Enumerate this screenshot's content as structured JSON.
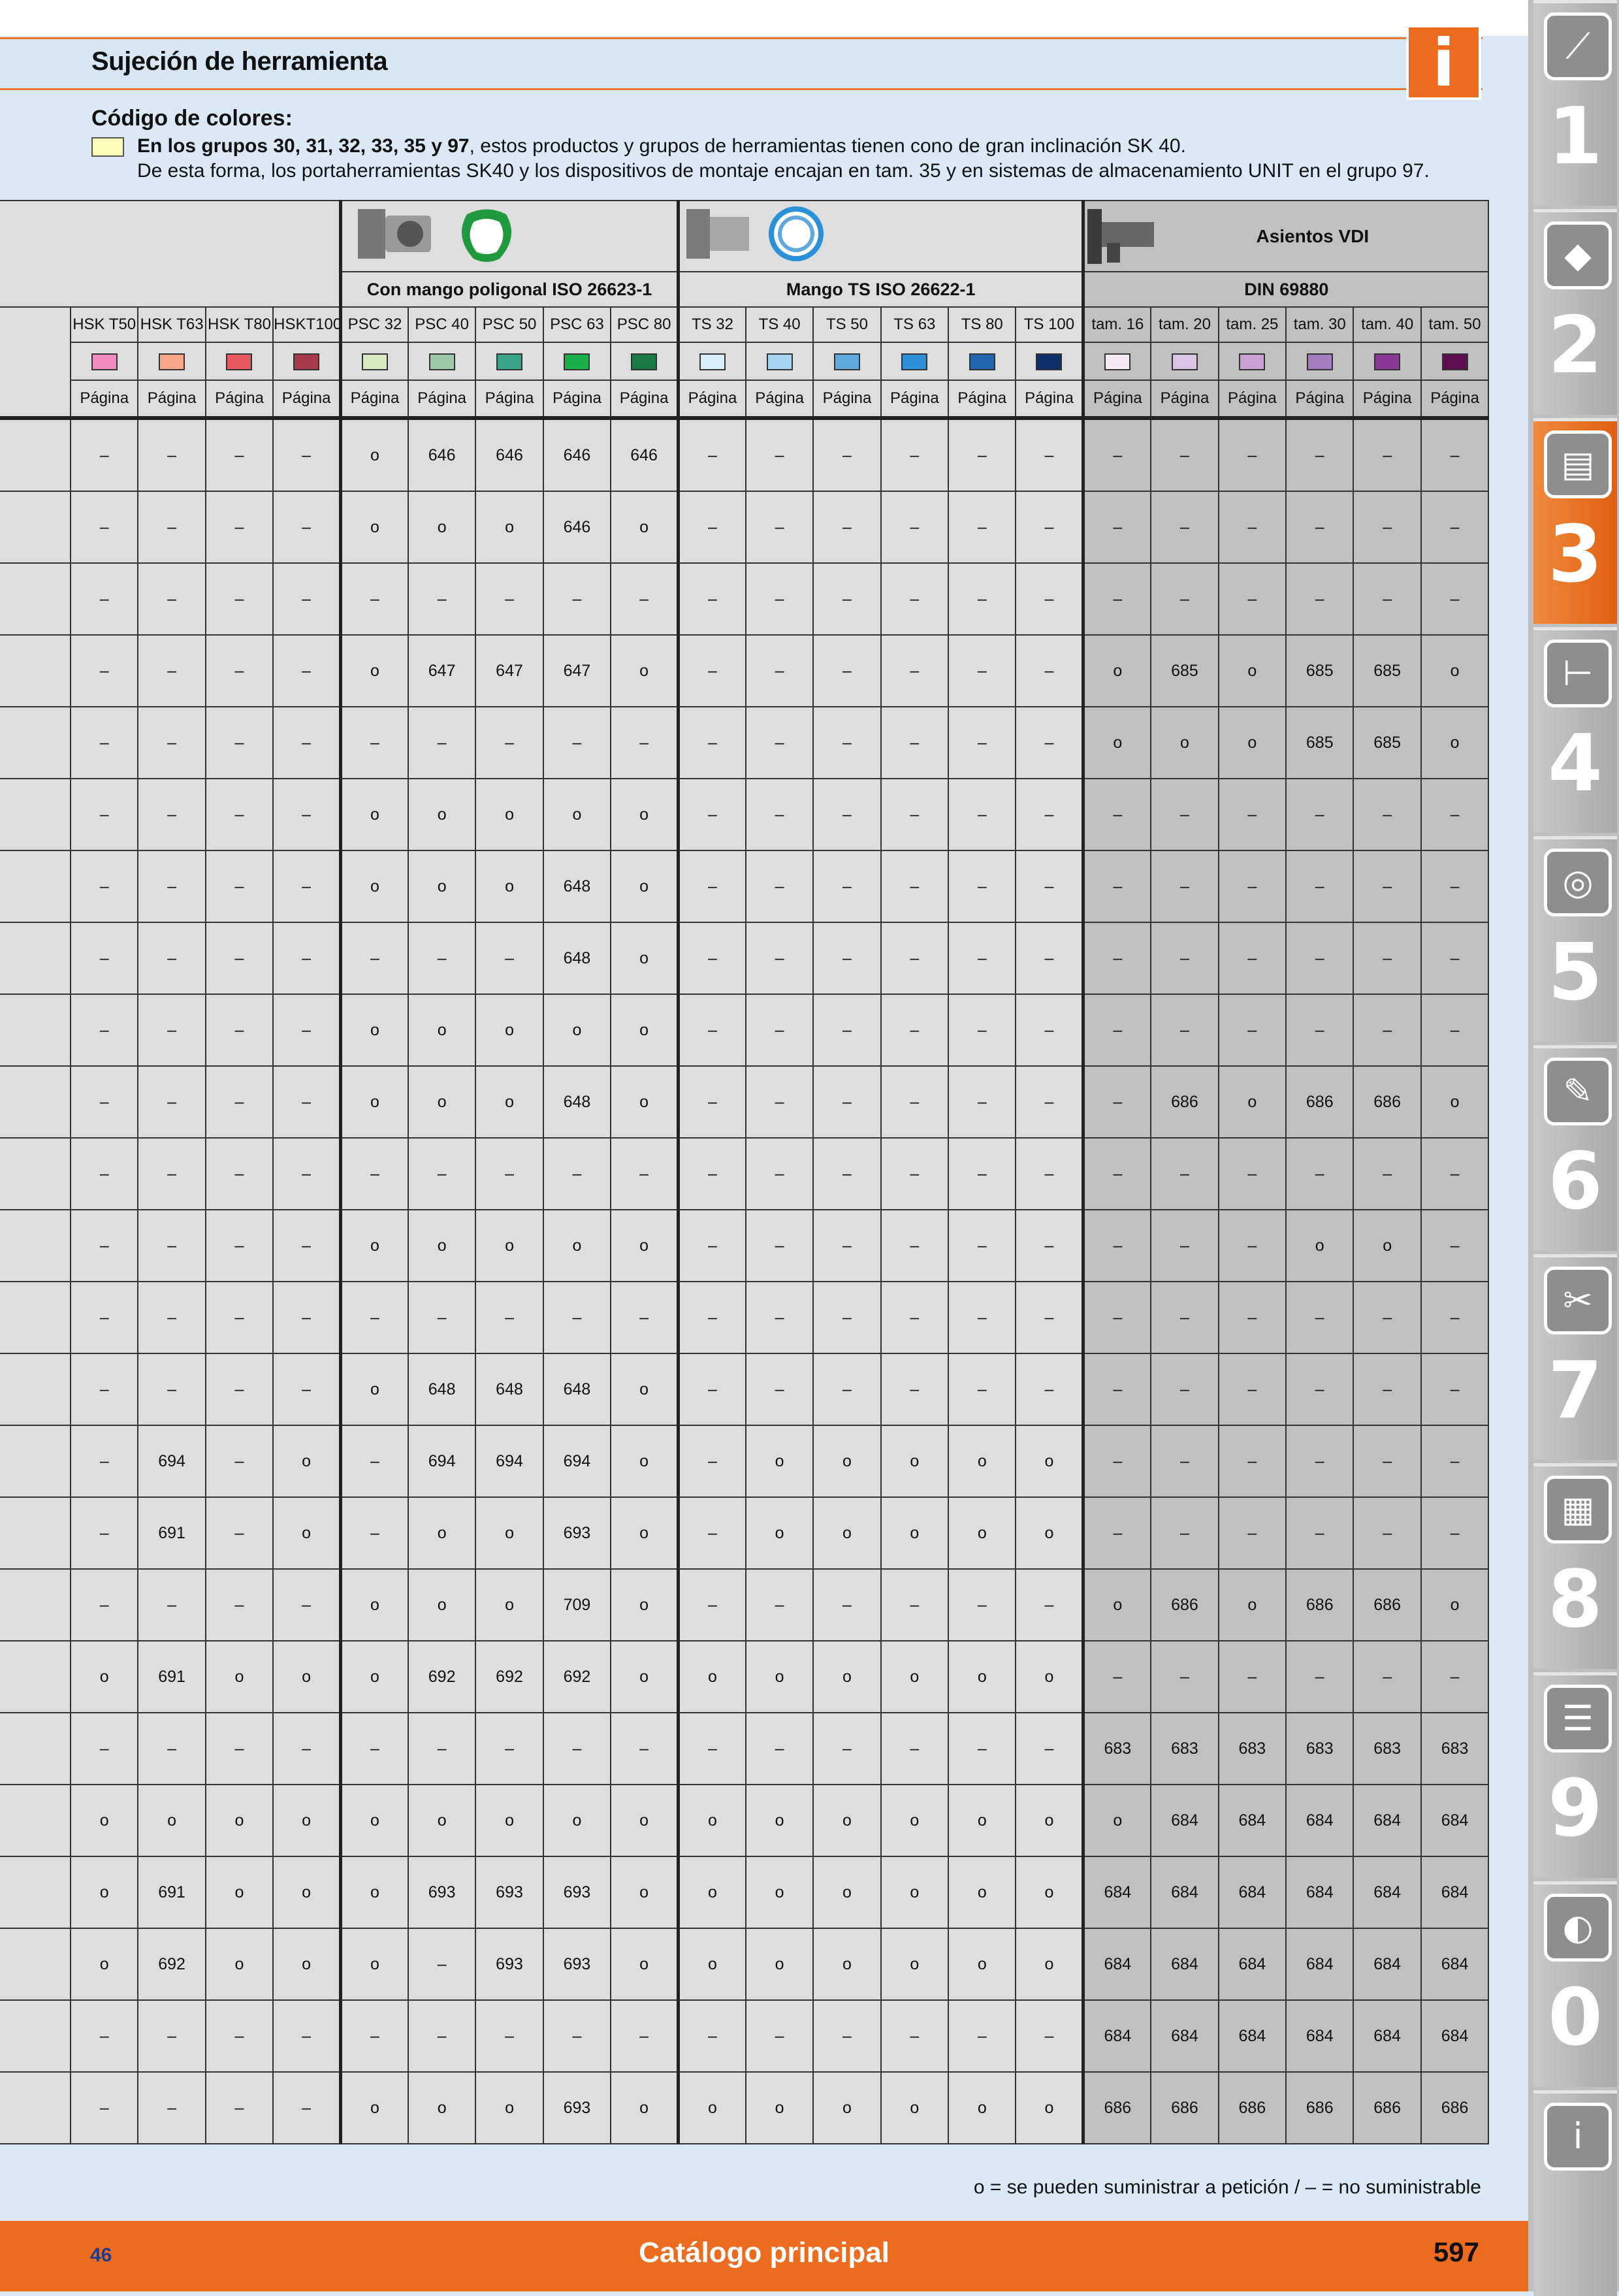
{
  "header": {
    "title": "Sujeción de herramienta",
    "info_icon": "i"
  },
  "legend": {
    "heading": "Código de colores:",
    "line1_bold": "En los grupos 30, 31, 32, 33, 35 y 97",
    "line1_rest": ", estos productos y grupos de herramientas tienen cono de gran inclinación SK 40.",
    "line2": "De esta forma, los portaherramientas SK40 y los dispositivos de montaje encajan en tam. 35 y en sistemas de almacenamiento UNIT en el grupo 97."
  },
  "table": {
    "vdi_heading": "Asientos VDI",
    "groups": [
      "Con mango poligonal ISO 26623-1",
      "Mango TS ISO 26622-1",
      "DIN 69880"
    ],
    "columns": [
      "HSK T50",
      "HSK T63",
      "HSK T80",
      "HSKT100",
      "PSC 32",
      "PSC 40",
      "PSC 50",
      "PSC 63",
      "PSC 80",
      "TS 32",
      "TS 40",
      "TS 50",
      "TS 63",
      "TS 80",
      "TS 100",
      "tam. 16",
      "tam. 20",
      "tam. 25",
      "tam. 30",
      "tam. 40",
      "tam. 50"
    ],
    "column_colors": [
      "#f08cc0",
      "#f8a58a",
      "#e8585e",
      "#a83a4c",
      "#d8e8c0",
      "#9ec8a8",
      "#3aa58a",
      "#1bb04a",
      "#1a7a44",
      "#d8eef8",
      "#a6d4f2",
      "#60a8e0",
      "#2a90d8",
      "#1e66b0",
      "#0e2f6a",
      "#f4e8f4",
      "#d8c4e4",
      "#c8a0d4",
      "#a47cc0",
      "#8a3a96",
      "#5e0e50"
    ],
    "page_label": "Página",
    "rows": [
      [
        "–",
        "–",
        "–",
        "–",
        "o",
        "646",
        "646",
        "646",
        "646",
        "–",
        "–",
        "–",
        "–",
        "–",
        "–",
        "–",
        "–",
        "–",
        "–",
        "–",
        "–"
      ],
      [
        "–",
        "–",
        "–",
        "–",
        "o",
        "o",
        "o",
        "646",
        "o",
        "–",
        "–",
        "–",
        "–",
        "–",
        "–",
        "–",
        "–",
        "–",
        "–",
        "–",
        "–"
      ],
      [
        "–",
        "–",
        "–",
        "–",
        "–",
        "–",
        "–",
        "–",
        "–",
        "–",
        "–",
        "–",
        "–",
        "–",
        "–",
        "–",
        "–",
        "–",
        "–",
        "–",
        "–"
      ],
      [
        "–",
        "–",
        "–",
        "–",
        "o",
        "647",
        "647",
        "647",
        "o",
        "–",
        "–",
        "–",
        "–",
        "–",
        "–",
        "o",
        "685",
        "o",
        "685",
        "685",
        "o"
      ],
      [
        "–",
        "–",
        "–",
        "–",
        "–",
        "–",
        "–",
        "–",
        "–",
        "–",
        "–",
        "–",
        "–",
        "–",
        "–",
        "o",
        "o",
        "o",
        "685",
        "685",
        "o"
      ],
      [
        "–",
        "–",
        "–",
        "–",
        "o",
        "o",
        "o",
        "o",
        "o",
        "–",
        "–",
        "–",
        "–",
        "–",
        "–",
        "–",
        "–",
        "–",
        "–",
        "–",
        "–"
      ],
      [
        "–",
        "–",
        "–",
        "–",
        "o",
        "o",
        "o",
        "648",
        "o",
        "–",
        "–",
        "–",
        "–",
        "–",
        "–",
        "–",
        "–",
        "–",
        "–",
        "–",
        "–"
      ],
      [
        "–",
        "–",
        "–",
        "–",
        "–",
        "–",
        "–",
        "648",
        "o",
        "–",
        "–",
        "–",
        "–",
        "–",
        "–",
        "–",
        "–",
        "–",
        "–",
        "–",
        "–"
      ],
      [
        "–",
        "–",
        "–",
        "–",
        "o",
        "o",
        "o",
        "o",
        "o",
        "–",
        "–",
        "–",
        "–",
        "–",
        "–",
        "–",
        "–",
        "–",
        "–",
        "–",
        "–"
      ],
      [
        "–",
        "–",
        "–",
        "–",
        "o",
        "o",
        "o",
        "648",
        "o",
        "–",
        "–",
        "–",
        "–",
        "–",
        "–",
        "–",
        "686",
        "o",
        "686",
        "686",
        "o"
      ],
      [
        "–",
        "–",
        "–",
        "–",
        "–",
        "–",
        "–",
        "–",
        "–",
        "–",
        "–",
        "–",
        "–",
        "–",
        "–",
        "–",
        "–",
        "–",
        "–",
        "–",
        "–"
      ],
      [
        "–",
        "–",
        "–",
        "–",
        "o",
        "o",
        "o",
        "o",
        "o",
        "–",
        "–",
        "–",
        "–",
        "–",
        "–",
        "–",
        "–",
        "–",
        "o",
        "o",
        "–"
      ],
      [
        "–",
        "–",
        "–",
        "–",
        "–",
        "–",
        "–",
        "–",
        "–",
        "–",
        "–",
        "–",
        "–",
        "–",
        "–",
        "–",
        "–",
        "–",
        "–",
        "–",
        "–"
      ],
      [
        "–",
        "–",
        "–",
        "–",
        "o",
        "648",
        "648",
        "648",
        "o",
        "–",
        "–",
        "–",
        "–",
        "–",
        "–",
        "–",
        "–",
        "–",
        "–",
        "–",
        "–"
      ],
      [
        "–",
        "694",
        "–",
        "o",
        "–",
        "694",
        "694",
        "694",
        "o",
        "–",
        "o",
        "o",
        "o",
        "o",
        "o",
        "–",
        "–",
        "–",
        "–",
        "–",
        "–"
      ],
      [
        "–",
        "691",
        "–",
        "o",
        "–",
        "o",
        "o",
        "693",
        "o",
        "–",
        "o",
        "o",
        "o",
        "o",
        "o",
        "–",
        "–",
        "–",
        "–",
        "–",
        "–"
      ],
      [
        "–",
        "–",
        "–",
        "–",
        "o",
        "o",
        "o",
        "709",
        "o",
        "–",
        "–",
        "–",
        "–",
        "–",
        "–",
        "o",
        "686",
        "o",
        "686",
        "686",
        "o"
      ],
      [
        "o",
        "691",
        "o",
        "o",
        "o",
        "692",
        "692",
        "692",
        "o",
        "o",
        "o",
        "o",
        "o",
        "o",
        "o",
        "–",
        "–",
        "–",
        "–",
        "–",
        "–"
      ],
      [
        "–",
        "–",
        "–",
        "–",
        "–",
        "–",
        "–",
        "–",
        "–",
        "–",
        "–",
        "–",
        "–",
        "–",
        "–",
        "683",
        "683",
        "683",
        "683",
        "683",
        "683"
      ],
      [
        "o",
        "o",
        "o",
        "o",
        "o",
        "o",
        "o",
        "o",
        "o",
        "o",
        "o",
        "o",
        "o",
        "o",
        "o",
        "o",
        "684",
        "684",
        "684",
        "684",
        "684"
      ],
      [
        "o",
        "691",
        "o",
        "o",
        "o",
        "693",
        "693",
        "693",
        "o",
        "o",
        "o",
        "o",
        "o",
        "o",
        "o",
        "684",
        "684",
        "684",
        "684",
        "684",
        "684"
      ],
      [
        "o",
        "692",
        "o",
        "o",
        "o",
        "–",
        "693",
        "693",
        "o",
        "o",
        "o",
        "o",
        "o",
        "o",
        "o",
        "684",
        "684",
        "684",
        "684",
        "684",
        "684"
      ],
      [
        "–",
        "–",
        "–",
        "–",
        "–",
        "–",
        "–",
        "–",
        "–",
        "–",
        "–",
        "–",
        "–",
        "–",
        "–",
        "684",
        "684",
        "684",
        "684",
        "684",
        "684"
      ],
      [
        "–",
        "–",
        "–",
        "–",
        "o",
        "o",
        "o",
        "693",
        "o",
        "o",
        "o",
        "o",
        "o",
        "o",
        "o",
        "686",
        "686",
        "686",
        "686",
        "686",
        "686"
      ]
    ]
  },
  "footnote": "o = se pueden suministrar a petición / – = no suministrable",
  "footer": {
    "left_number": "46",
    "center_title": "Catálogo principal",
    "page_number": "597"
  },
  "side_tabs": [
    {
      "number": "1",
      "icon": "drill-icon",
      "active": false
    },
    {
      "number": "2",
      "icon": "insert-icon",
      "active": false
    },
    {
      "number": "3",
      "icon": "toolholder-icon",
      "active": true
    },
    {
      "number": "4",
      "icon": "caliper-icon",
      "active": false
    },
    {
      "number": "5",
      "icon": "grinding-disc-icon",
      "active": false
    },
    {
      "number": "6",
      "icon": "wrench-icon",
      "active": false
    },
    {
      "number": "7",
      "icon": "pliers-icon",
      "active": false
    },
    {
      "number": "8",
      "icon": "toolbox-icon",
      "active": false
    },
    {
      "number": "9",
      "icon": "cabinet-icon",
      "active": false
    },
    {
      "number": "0",
      "icon": "safety-goggles-icon",
      "active": false
    },
    {
      "number": "",
      "icon": "info-icon",
      "active": false
    }
  ]
}
